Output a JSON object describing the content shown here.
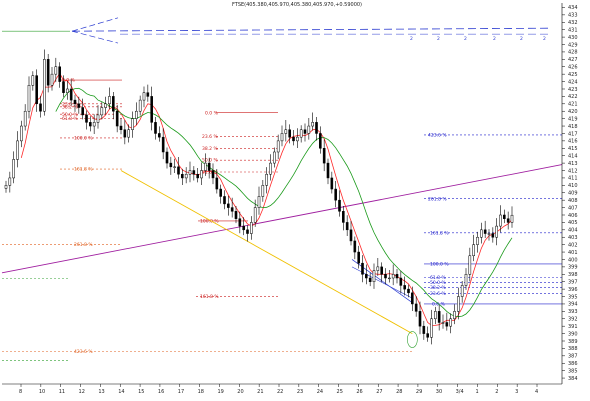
{
  "chart_data": {
    "type": "candlestick",
    "title": "FTSE(405.380,405.970,405.380,405.970,+0.59000)",
    "y_axis_position": "right",
    "ylim": [
      383.2,
      434.6
    ],
    "y_ticks": [
      384,
      385,
      386,
      387,
      388,
      389,
      390,
      391,
      392,
      393,
      394,
      395,
      396,
      397,
      398,
      399,
      400,
      401,
      402,
      403,
      404,
      405,
      406,
      407,
      408,
      409,
      410,
      411,
      412,
      413,
      414,
      415,
      416,
      417,
      418,
      419,
      420,
      421,
      422,
      423,
      424,
      425,
      426,
      427,
      428,
      429,
      430,
      431,
      432,
      433,
      434
    ],
    "x_tick_labels": [
      "8",
      "10",
      "11",
      "12",
      "13",
      "14",
      "15",
      "16",
      "17",
      "18",
      "19",
      "20",
      "21",
      "22",
      "23",
      "24",
      "25",
      "26",
      "27",
      "28",
      "29",
      "30",
      "3/4",
      "1",
      "2",
      "3",
      "4"
    ],
    "grid": false,
    "legend": "none",
    "colors": {
      "candle": "#000000",
      "ma_fast": "#ff2a2a",
      "ma_slow": "#1a9a1a",
      "trendline": "#a020a0",
      "support_line": "#f0c000",
      "dashed_projection": "#2a3ad0",
      "fib_red": "#cc2020",
      "fib_blue": "#2020cc",
      "fib_orange": "#e06020",
      "fib_green": "#30a030"
    },
    "fib_labels": {
      "left": [
        "0.0 %",
        "23.6 %",
        "38.2 %",
        "50.0 %",
        "61.8 %",
        "100.0 %",
        "161.8 %",
        "261.8 %",
        "423.6 %"
      ],
      "mid": [
        "0.0 %",
        "23.6 %",
        "38.2 %",
        "50.0 %",
        "61.8 %",
        "100.0 %",
        "161.8 %"
      ],
      "right": [
        "423.6 %",
        "261.8 %",
        "161.8 %",
        "100.0 %",
        "61.8 %",
        "50.0 %",
        "38.2 %",
        "23.6 %",
        "0.0 %"
      ]
    },
    "dashed_markers": [
      "2",
      "2",
      "2",
      "2",
      "2",
      "2"
    ],
    "closes": [
      410,
      411,
      413.5,
      416,
      418,
      420,
      423.5,
      424.8,
      421,
      420,
      427,
      423.5,
      425,
      426,
      424,
      422.5,
      423,
      421.5,
      421,
      420.5,
      419.5,
      418.5,
      418,
      418.5,
      419.5,
      420.5,
      421,
      422,
      420,
      418,
      417.5,
      416.5,
      417.5,
      419,
      420,
      421.5,
      422.5,
      422,
      418.5,
      417,
      416.5,
      414.5,
      413,
      412.5,
      412.5,
      411.5,
      411,
      411.5,
      412,
      411.5,
      411,
      412,
      413,
      412,
      411,
      409.5,
      408.5,
      407.5,
      407,
      406.5,
      405.5,
      404.5,
      404,
      403.5,
      405,
      407,
      408.5,
      410,
      411.5,
      413,
      414.5,
      416,
      417,
      417.5,
      416.5,
      416,
      416.5,
      417.5,
      417,
      418,
      418.5,
      417,
      415,
      413,
      411,
      409.5,
      408,
      406.5,
      405,
      404,
      402.5,
      401,
      399.5,
      398,
      397.5,
      397,
      398.5,
      399,
      398,
      397.5,
      397.5,
      398,
      397.5,
      396.5,
      396,
      395.5,
      394,
      393,
      391,
      390,
      389.5,
      392,
      393,
      391.5,
      391.5,
      391,
      392,
      393,
      395,
      396.5,
      398,
      400.5,
      402,
      403,
      404,
      403.5,
      403.5,
      403,
      404.5,
      406,
      405.5,
      405,
      405.97
    ]
  }
}
